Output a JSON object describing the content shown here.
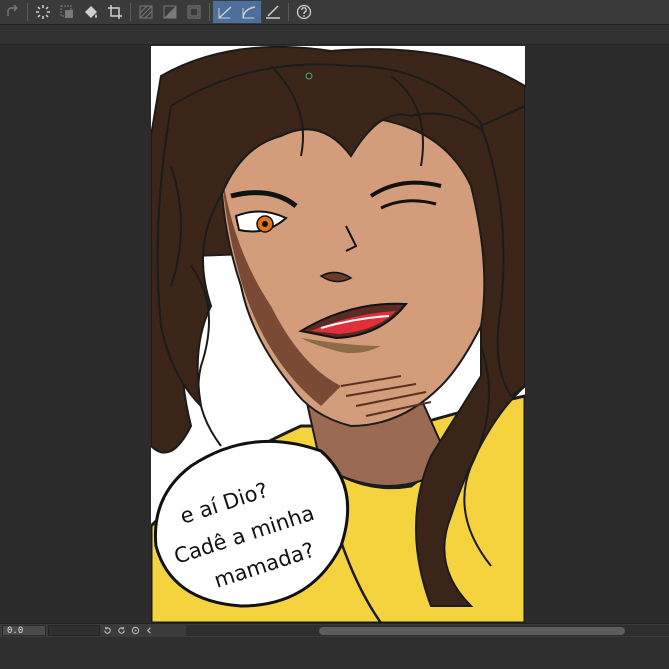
{
  "toolbar": {
    "icons": [
      "redo-icon",
      "select-all-icon",
      "select-layer-icon",
      "fill-icon",
      "crop-icon",
      "tone-icon",
      "gradient-icon",
      "frame-icon",
      "pen-line-icon",
      "curve-icon",
      "ruler-icon",
      "help-icon"
    ]
  },
  "status": {
    "zoom_value": "0.0"
  },
  "canvas": {
    "speech_bubble": {
      "line1": "e aí Dio?",
      "line2": "Cadê a minha",
      "line3": "mamada?"
    }
  },
  "colors": {
    "app_bg": "#2b2b2b",
    "toolbar_bg": "#3a3a3a",
    "active_tool": "#4d6f9a",
    "shirt": "#f4d33f",
    "skin": "#d39d7c",
    "hair": "#3b2518"
  }
}
